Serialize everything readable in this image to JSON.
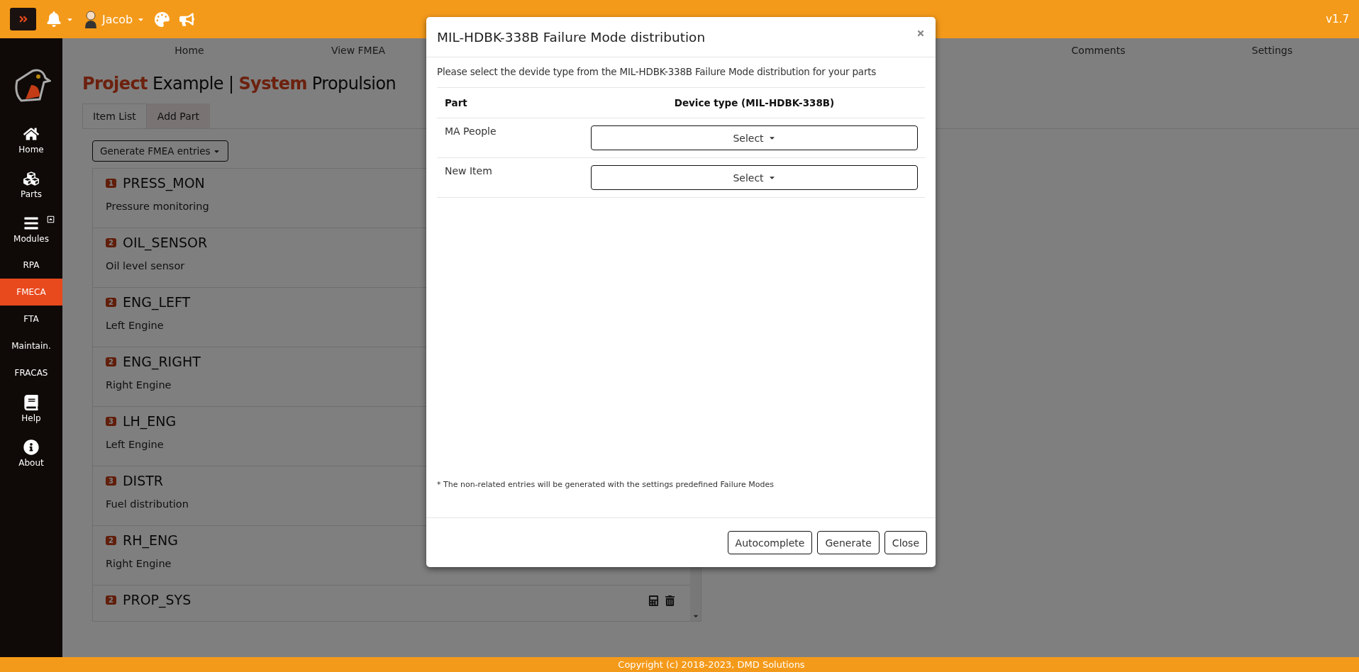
{
  "topbar": {
    "user": "Jacob",
    "version": "v1.7"
  },
  "nav": [
    {
      "label": "Home"
    },
    {
      "label": "View FMEA"
    },
    {
      "label": "Comments"
    },
    {
      "label": "Settings"
    }
  ],
  "sidebar": {
    "items": [
      {
        "label": "Home",
        "kind": "home",
        "selected": false
      },
      {
        "label": "Parts",
        "kind": "parts",
        "selected": false
      },
      {
        "label": "Modules",
        "kind": "modules",
        "selected": false
      },
      {
        "label": "RPA",
        "kind": "text",
        "selected": false
      },
      {
        "label": "FMECA",
        "kind": "text",
        "selected": true
      },
      {
        "label": "FTA",
        "kind": "text",
        "selected": false
      },
      {
        "label": "Maintain.",
        "kind": "text",
        "selected": false
      },
      {
        "label": "FRACAS",
        "kind": "text",
        "selected": false
      },
      {
        "label": "Help",
        "kind": "help",
        "selected": false
      },
      {
        "label": "About",
        "kind": "about",
        "selected": false
      }
    ]
  },
  "heading": "**Project** Example | **System** Propulsion",
  "tabs": [
    {
      "label": "Item List",
      "selected": true
    },
    {
      "label": "Add Part",
      "selected": false
    }
  ],
  "generate_button": "Generate FMEA entries",
  "items": [
    {
      "badge": "1",
      "code": "PRESS_MON",
      "description": "Pressure monitoring"
    },
    {
      "badge": "2",
      "code": "OIL_SENSOR",
      "description": "Oil level sensor"
    },
    {
      "badge": "2",
      "code": "ENG_LEFT",
      "description": "Left Engine"
    },
    {
      "badge": "2",
      "code": "ENG_RIGHT",
      "description": "Right Engine"
    },
    {
      "badge": "3",
      "code": "LH_ENG",
      "description": "Left Engine"
    },
    {
      "badge": "3",
      "code": "DISTR",
      "description": "Fuel distribution"
    },
    {
      "badge": "2",
      "code": "RH_ENG",
      "description": "Right Engine"
    },
    {
      "badge": "2",
      "code": "PROP_SYS",
      "actions": true
    }
  ],
  "modal": {
    "title": "MIL-HDBK-338B Failure Mode distribution",
    "intro": "Please select the devide type from the MIL-HDBK-338B Failure Mode distribution for your parts",
    "columns": [
      "Part",
      "Device type (MIL-HDBK-338B)"
    ],
    "rows": [
      {
        "part": "MA People",
        "select": "Select"
      },
      {
        "part": "New Item",
        "select": "Select"
      }
    ],
    "note": "* The non-related entries will be generated with the settings predefined Failure Modes",
    "buttons": [
      "Autocomplete",
      "Generate",
      "Close"
    ]
  },
  "footer": "Copyright (c) 2018-2023, DMD Solutions"
}
